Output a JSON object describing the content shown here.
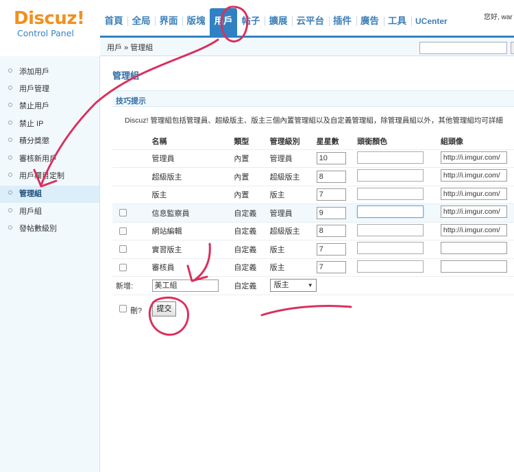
{
  "logo": {
    "main": "Discuz!",
    "sub": "Control Panel"
  },
  "nav": {
    "items": [
      {
        "label": "首頁"
      },
      {
        "label": "全局"
      },
      {
        "label": "界面"
      },
      {
        "label": "版塊"
      },
      {
        "label": "用戶"
      },
      {
        "label": "帖子"
      },
      {
        "label": "擴展"
      },
      {
        "label": "云平台"
      },
      {
        "label": "插件"
      },
      {
        "label": "廣告"
      },
      {
        "label": "工具"
      },
      {
        "label": "UCenter"
      }
    ],
    "active_index": 4,
    "greeting": "您好, war"
  },
  "breadcrumb": "用戶 » 管理組",
  "search": {
    "value": ""
  },
  "sidebar": {
    "items": [
      {
        "label": "添加用戶"
      },
      {
        "label": "用戶管理"
      },
      {
        "label": "禁止用戶"
      },
      {
        "label": "禁止 IP"
      },
      {
        "label": "積分獎懲"
      },
      {
        "label": "審核新用戶"
      },
      {
        "label": "用戶欄目定制"
      },
      {
        "label": "管理組"
      },
      {
        "label": "用戶組"
      },
      {
        "label": "發帖數級別"
      }
    ],
    "active_index": 7
  },
  "page_title": "管理組",
  "tips": {
    "title": "技巧提示",
    "text": "Discuz! 管理組包括管理員、超級版主、版主三個內置管理組以及自定義管理組，除管理員組以外，其他管理組均可詳細"
  },
  "table": {
    "headers": {
      "name": "名稱",
      "type": "類型",
      "level": "管理級別",
      "stars": "星星數",
      "color": "頭銜顏色",
      "icon": "組頭像"
    },
    "rows": [
      {
        "name": "管理員",
        "type": "內置",
        "level": "管理員",
        "stars": "10",
        "color": "",
        "icon": "http://i.imgur.com/",
        "has_checkbox": false
      },
      {
        "name": "超級版主",
        "type": "內置",
        "level": "超級版主",
        "stars": "8",
        "color": "",
        "icon": "http://i.imgur.com/",
        "has_checkbox": false
      },
      {
        "name": "版主",
        "type": "內置",
        "level": "版主",
        "stars": "7",
        "color": "",
        "icon": "http://i.imgur.com/",
        "has_checkbox": false
      },
      {
        "name": "信息監察員",
        "type": "自定義",
        "level": "管理員",
        "stars": "9",
        "color": "",
        "icon": "http://i.imgur.com/",
        "has_checkbox": true
      },
      {
        "name": "網站編輯",
        "type": "自定義",
        "level": "超級版主",
        "stars": "8",
        "color": "",
        "icon": "http://i.imgur.com/",
        "has_checkbox": true
      },
      {
        "name": "實習版主",
        "type": "自定義",
        "level": "版主",
        "stars": "7",
        "color": "",
        "icon": "",
        "has_checkbox": true
      },
      {
        "name": "審核員",
        "type": "自定義",
        "level": "版主",
        "stars": "7",
        "color": "",
        "icon": "",
        "has_checkbox": true
      }
    ],
    "new_row": {
      "label": "新增:",
      "name_value": "美工組",
      "type": "自定義",
      "level_selected": "版主"
    }
  },
  "footer": {
    "delete_label": "刪?",
    "submit_label": "提交"
  },
  "colors": {
    "accent": "#2f81c3",
    "logo_orange": "#f1901f",
    "annotation": "#d9305c"
  }
}
